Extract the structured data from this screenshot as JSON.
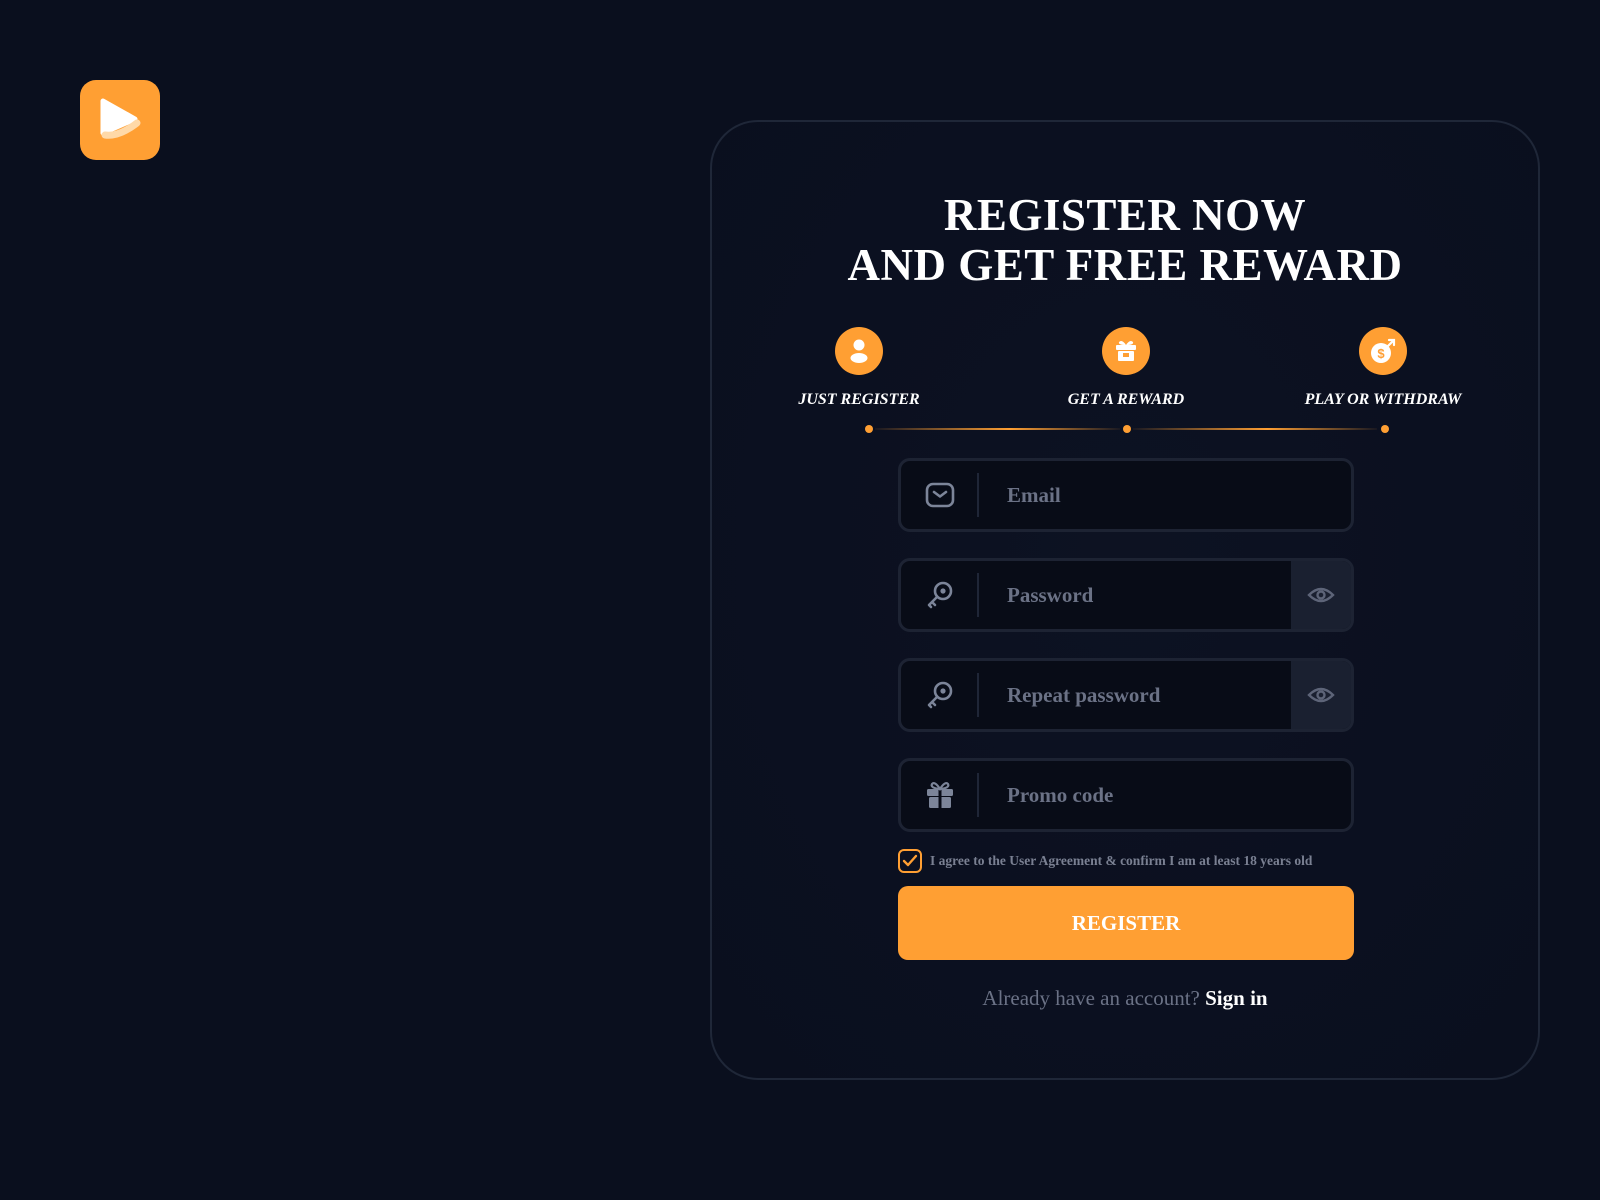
{
  "brand": {
    "logo_icon": "play-logo-icon",
    "accent_color": "#ff9f33"
  },
  "form": {
    "title_line1": "REGISTER NOW",
    "title_line2": "AND GET FREE REWARD",
    "steps": [
      {
        "label": "JUST REGISTER",
        "icon": "user-icon"
      },
      {
        "label": "GET A REWARD",
        "icon": "gift-box-icon"
      },
      {
        "label": "PLAY OR WITHDRAW",
        "icon": "money-bag-icon"
      }
    ],
    "email": {
      "placeholder": "Email",
      "value": ""
    },
    "password": {
      "placeholder": "Password",
      "value": ""
    },
    "repeat_password": {
      "placeholder": "Repeat password",
      "value": ""
    },
    "promo": {
      "placeholder": "Promo code",
      "value": ""
    },
    "agreement": {
      "checked": true,
      "text": "I agree to the User Agreement & confirm I am at least 18 years old"
    },
    "register_label": "REGISTER",
    "signin_question": "Already have an account?",
    "signin_link": "Sign in"
  },
  "colors": {
    "background": "#0a0f1e",
    "field_border": "#1d2333",
    "placeholder": "#6b7286",
    "icon_gray": "#7c8599"
  }
}
